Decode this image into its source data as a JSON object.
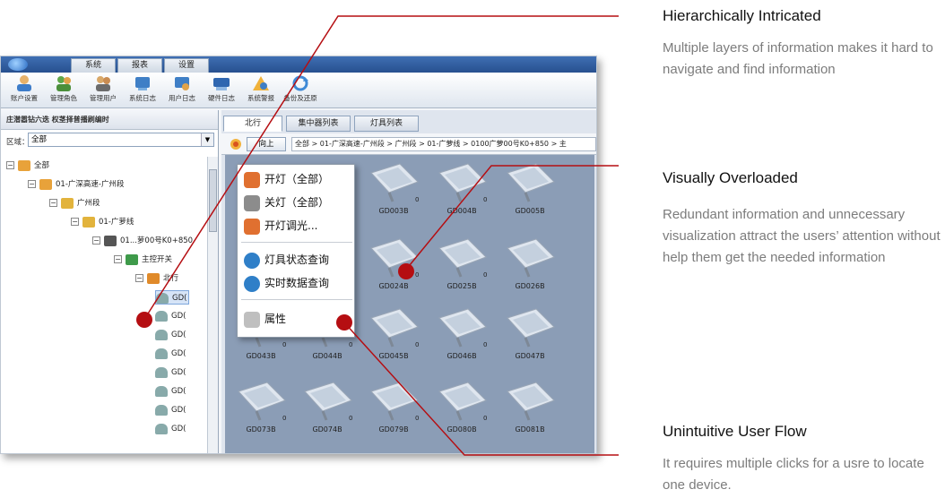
{
  "app": {
    "tabs": [
      "系统",
      "报表",
      "设置"
    ],
    "toolbar": [
      {
        "label": "账户设置",
        "icon": "user-settings-icon"
      },
      {
        "label": "管理角色",
        "icon": "roles-icon"
      },
      {
        "label": "管理用户",
        "icon": "users-icon"
      },
      {
        "label": "系统日志",
        "icon": "system-log-icon"
      },
      {
        "label": "用户日志",
        "icon": "user-log-icon"
      },
      {
        "label": "硬件日志",
        "icon": "hardware-log-icon"
      },
      {
        "label": "系统警报",
        "icon": "alarm-icon"
      },
      {
        "label": "备份及还原",
        "icon": "backup-icon"
      }
    ],
    "left_panel": {
      "header": "庄潜嚣钻六迭 权茎择普播刷编时",
      "region_label": "区域：",
      "region_value": "全部",
      "tree": [
        {
          "label": "全部",
          "level": 0,
          "icon": "home-icon"
        },
        {
          "label": "01-广深高速-广州段",
          "level": 1,
          "icon": "home-icon"
        },
        {
          "label": "广州段",
          "level": 2,
          "icon": "folder-icon"
        },
        {
          "label": "01-广萝线",
          "level": 3,
          "icon": "folder-icon"
        },
        {
          "label": "01...萝00号K0+850",
          "level": 4,
          "icon": "cabinet-icon"
        },
        {
          "label": "主控开关",
          "level": 5,
          "icon": "switch-icon"
        },
        {
          "label": "北行",
          "level": 6,
          "icon": "direction-icon"
        },
        {
          "label": "GD(",
          "level": 7,
          "icon": "lamp-icon"
        },
        {
          "label": "GD(",
          "level": 7,
          "icon": "lamp-icon"
        },
        {
          "label": "GD(",
          "level": 7,
          "icon": "lamp-icon"
        },
        {
          "label": "GD(",
          "level": 7,
          "icon": "lamp-icon"
        },
        {
          "label": "GD(",
          "level": 7,
          "icon": "lamp-icon"
        },
        {
          "label": "GD(",
          "level": 7,
          "icon": "lamp-icon"
        },
        {
          "label": "GD(",
          "level": 7,
          "icon": "lamp-icon"
        },
        {
          "label": "GD(",
          "level": 7,
          "icon": "lamp-icon"
        }
      ]
    },
    "main_panel": {
      "tabs": [
        "北行",
        "集中器列表",
        "灯具列表"
      ],
      "up_button": "向上",
      "breadcrumb": "全部 > 01-广深高速-广州段 > 广州段 > 01-广萝线 > 0100广萝00号K0+850 > 主",
      "devices": [
        {
          "id": "GD003B",
          "count": "0"
        },
        {
          "id": "GD004B",
          "count": "0"
        },
        {
          "id": "GD005B",
          "count": ""
        },
        {
          "id": "GD024B",
          "count": "0"
        },
        {
          "id": "GD025B",
          "count": "0"
        },
        {
          "id": "GD026B",
          "count": ""
        },
        {
          "id": "GD043B",
          "count": "0"
        },
        {
          "id": "GD044B",
          "count": "0"
        },
        {
          "id": "GD045B",
          "count": "0"
        },
        {
          "id": "GD046B",
          "count": "0"
        },
        {
          "id": "GD047B",
          "count": ""
        },
        {
          "id": "GD073B",
          "count": "0"
        },
        {
          "id": "GD074B",
          "count": "0"
        },
        {
          "id": "GD079B",
          "count": "0"
        },
        {
          "id": "GD080B",
          "count": "0"
        },
        {
          "id": "GD081B",
          "count": ""
        }
      ]
    },
    "context_menu": [
      {
        "label": "开灯（全部）",
        "icon": "lamp-on-icon",
        "color": "#e07030"
      },
      {
        "label": "关灯（全部）",
        "icon": "lamp-off-icon",
        "color": "#8c8c8c"
      },
      {
        "label": "开灯调光...",
        "icon": "dimmer-icon",
        "color": "#e07030"
      },
      {
        "label": "灯具状态查询",
        "icon": "status-query-icon",
        "color": "#2f7fc8"
      },
      {
        "label": "实时数据查询",
        "icon": "realtime-data-icon",
        "color": "#2f7fc8"
      },
      {
        "label": "属性",
        "icon": "properties-icon",
        "color": "#bfbfbf"
      }
    ]
  },
  "annotations": [
    {
      "heading": "Hierarchically Intricated",
      "body": "Multiple layers of information makes it hard to navigate and find information"
    },
    {
      "heading": "Visually Overloaded",
      "body": "Redundant information and unnecessary visualization attract the users’ attention without help them get the needed information"
    },
    {
      "heading": "Unintuitive User Flow",
      "body": "It requires multiple clicks for a usre to locate one device."
    }
  ],
  "colors": {
    "accent_red": "#b50e12",
    "grid_bg": "#8b9db6"
  }
}
